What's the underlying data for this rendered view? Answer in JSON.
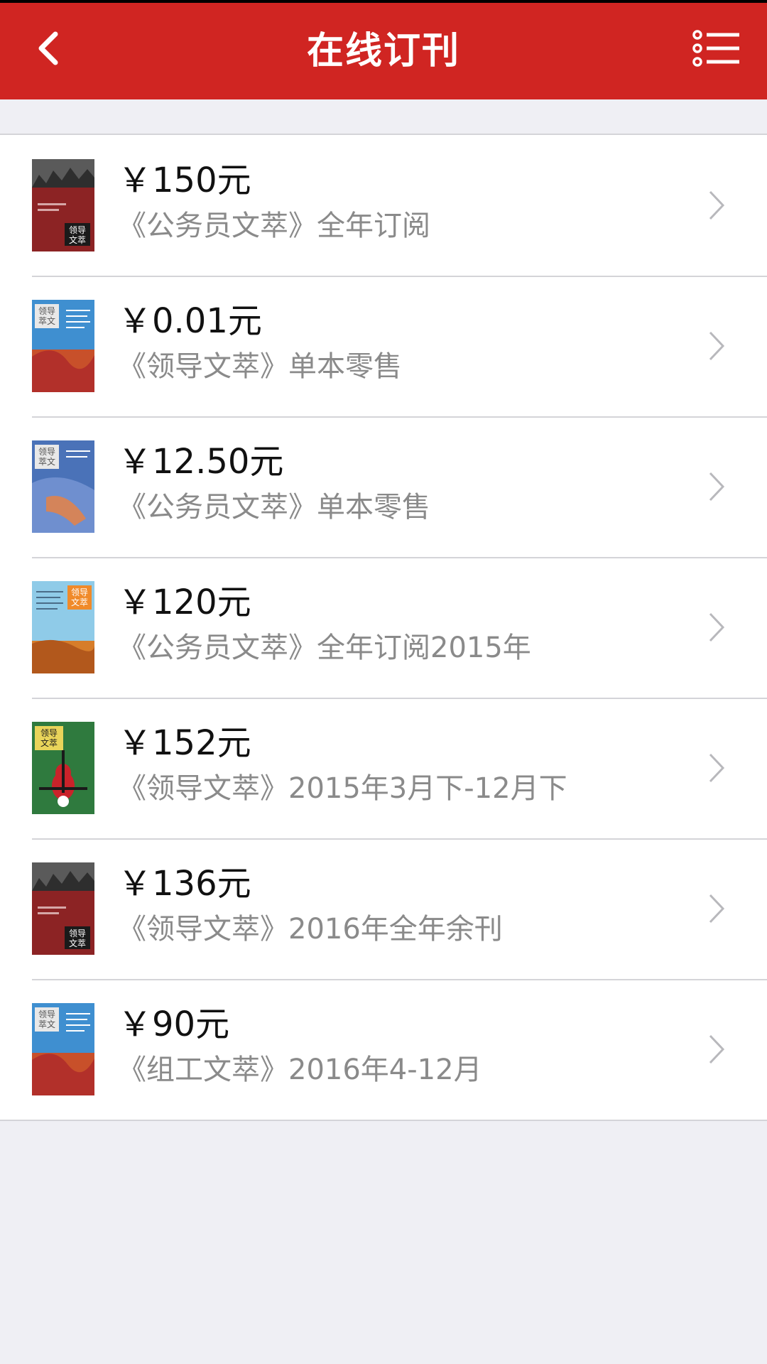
{
  "header": {
    "title": "在线订刊",
    "back_icon": "chevron-left-icon",
    "menu_icon": "list-menu-icon",
    "background": "#d02522"
  },
  "subscriptions": [
    {
      "price": "￥150元",
      "title": "《公务员文萃》全年订阅",
      "cover_text": "领导\n文萃",
      "cover": "dark-red"
    },
    {
      "price": "￥0.01元",
      "title": "《领导文萃》单本零售",
      "cover_text": "领导\n萃文",
      "cover": "blue-desert"
    },
    {
      "price": "￥12.50元",
      "title": "《公务员文萃》单本零售",
      "cover_text": "领导\n萃文",
      "cover": "blue-hand"
    },
    {
      "price": "￥120元",
      "title": "《公务员文萃》全年订阅2015年",
      "cover_text": "领导\n文萃",
      "cover": "sky-dunes"
    },
    {
      "price": "￥152元",
      "title": "《领导文萃》2015年3月下-12月下",
      "cover_text": "领导\n文萃",
      "cover": "green-violin"
    },
    {
      "price": "￥136元",
      "title": "《领导文萃》2016年全年余刊",
      "cover_text": "领导\n文萃",
      "cover": "dark-red"
    },
    {
      "price": "￥90元",
      "title": "《组工文萃》2016年4-12月",
      "cover_text": "领导\n萃文",
      "cover": "blue-desert"
    }
  ]
}
